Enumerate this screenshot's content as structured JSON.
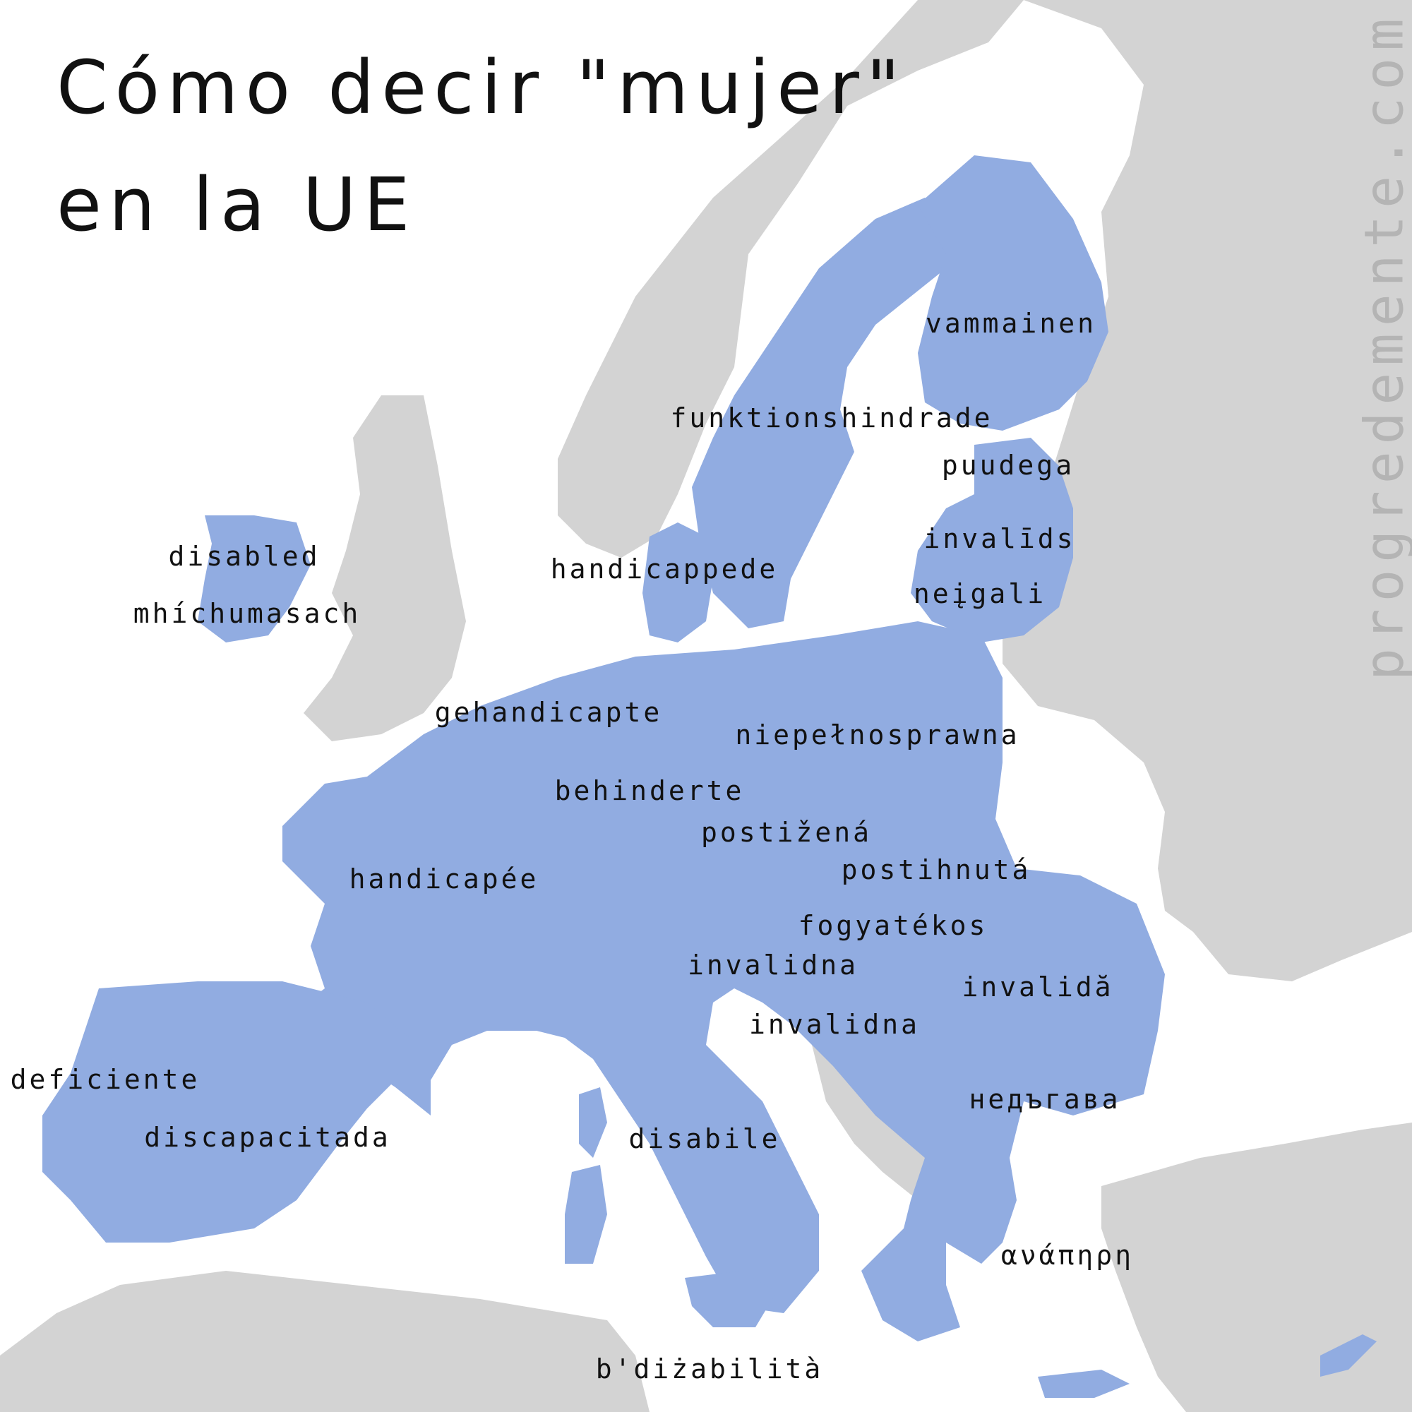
{
  "title": {
    "line1": "Cómo decir \"mujer\"",
    "line2": "en la UE"
  },
  "watermark": "progredemente.com",
  "colors": {
    "background": "#ffffff",
    "eu_member": "#91ace1",
    "non_eu_land": "#d3d3d3",
    "text": "#111111",
    "watermark": "#b4b4b4"
  },
  "labels": {
    "finland": "vammainen",
    "sweden": "funktionshindrade",
    "estonia": "puudega",
    "latvia": "invalīds",
    "lithuania": "neįgali",
    "ireland_en": "disabled",
    "ireland_ga": "mhíchumasach",
    "denmark": "handicappede",
    "netherlands": "gehandicapte",
    "poland": "niepełnosprawna",
    "germany": "behinderte",
    "czechia": "postižená",
    "slovakia": "postihnutá",
    "france": "handicapée",
    "hungary": "fogyatékos",
    "slovenia": "invalidna",
    "croatia": "invalidna",
    "romania": "invalidă",
    "portugal": "deficiente",
    "spain": "discapacitada",
    "italy": "disabile",
    "bulgaria": "недъгава",
    "greece": "ανάπηρη",
    "malta": "b'diżabilità"
  }
}
